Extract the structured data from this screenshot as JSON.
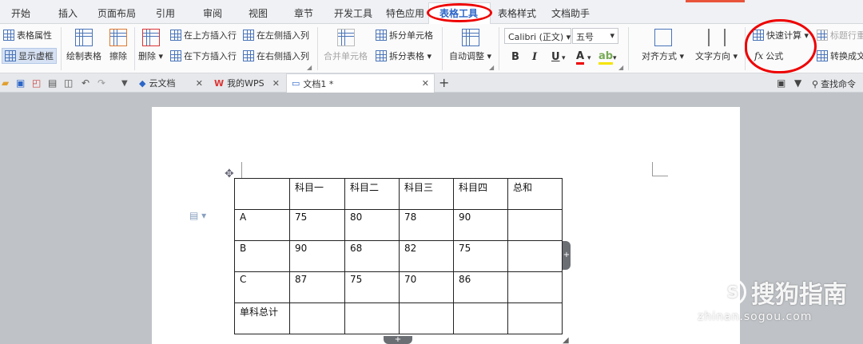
{
  "menu_tabs": [
    "开始",
    "插入",
    "页面布局",
    "引用",
    "审阅",
    "视图",
    "章节",
    "开发工具",
    "特色应用",
    "表格工具",
    "表格样式",
    "文档助手"
  ],
  "ribbon": {
    "table_properties": "表格属性",
    "show_gridlines": "显示虚框",
    "draw_table": "绘制表格",
    "eraser": "擦除",
    "delete": "删除",
    "insert_row_above": "在上方插入行",
    "insert_row_below": "在下方插入行",
    "insert_col_left": "在左侧插入列",
    "insert_col_right": "在右侧插入列",
    "merge_cells": "合并单元格",
    "split_cells": "拆分单元格",
    "split_table": "拆分表格",
    "auto_adjust": "自动调整",
    "font_name": "Calibri (正文)",
    "font_size": "五号",
    "bold": "B",
    "italic": "I",
    "underline": "U",
    "font_color": "A",
    "align": "对齐方式",
    "text_direction": "文字方向",
    "quick_calc": "快速计算",
    "formula": "公式",
    "title_row_repeat": "标题行重",
    "convert_text": "转换成文"
  },
  "doc_tabs": {
    "cloud_docs": "云文档",
    "my_wps": "我的WPS",
    "document": "文档1 *",
    "search_cmd": "查找命令"
  },
  "table": {
    "header": [
      "",
      "科目一",
      "科目二",
      "科目三",
      "科目四",
      "总和"
    ],
    "rows": [
      [
        "A",
        "75",
        "80",
        "78",
        "90",
        ""
      ],
      [
        "B",
        "90",
        "68",
        "82",
        "75",
        ""
      ],
      [
        "C",
        "87",
        "75",
        "70",
        "86",
        ""
      ],
      [
        "单科总计",
        "",
        "",
        "",
        "",
        ""
      ]
    ]
  },
  "watermark": {
    "brand": "搜狗指南",
    "url": "zhinan.sogou.com"
  },
  "colors": {
    "active_tab": "#2c66c8",
    "annotation_red": "#ee0000"
  }
}
